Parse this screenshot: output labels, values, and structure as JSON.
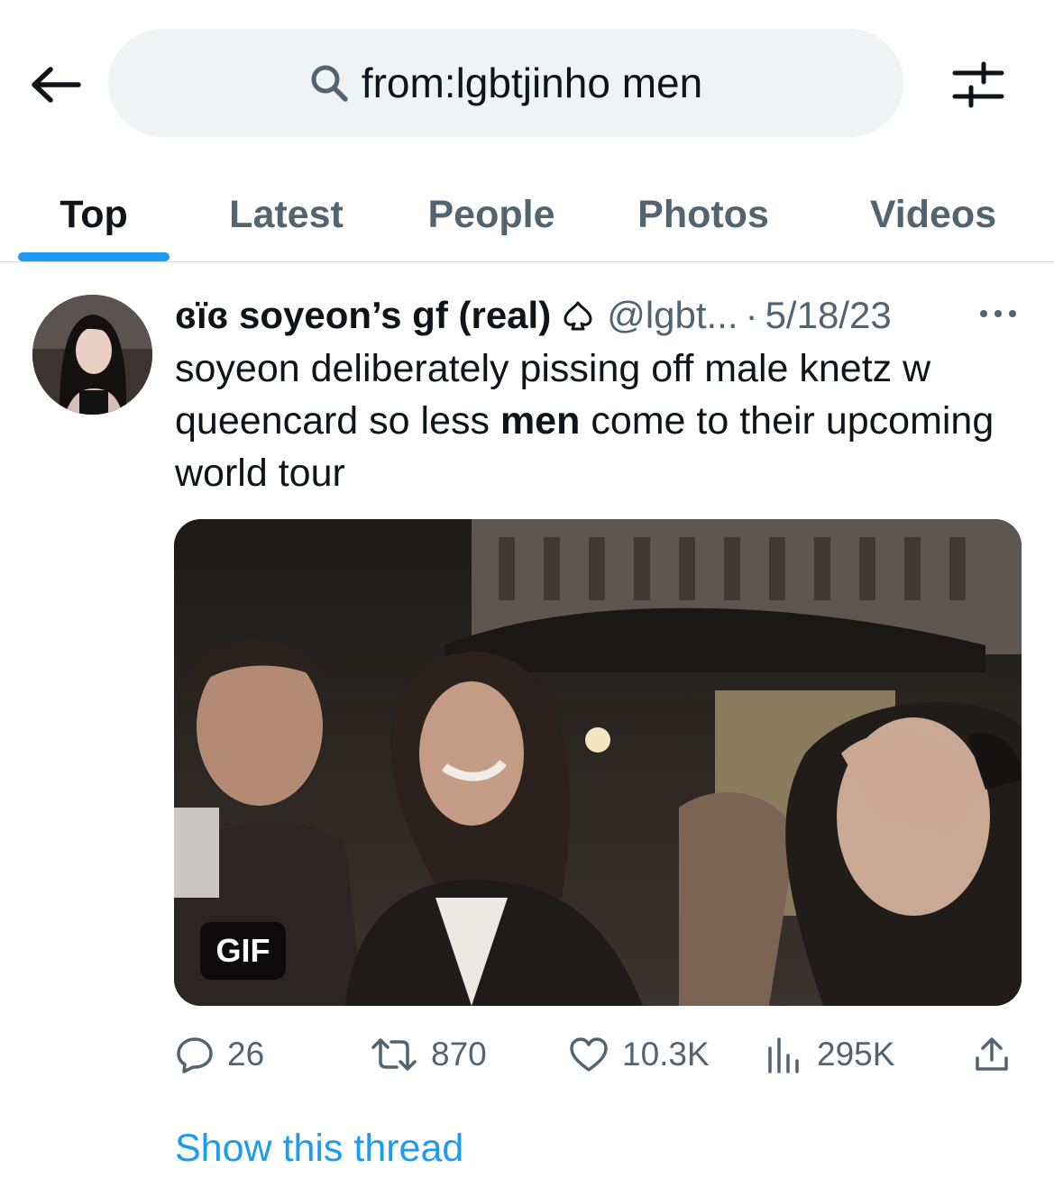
{
  "search": {
    "query": "from:lgbtjinho men",
    "icon": "search-icon"
  },
  "header": {
    "back_icon": "arrow-left-icon",
    "filter_icon": "sliders-icon"
  },
  "tabs": [
    {
      "label": "Top",
      "active": true
    },
    {
      "label": "Latest",
      "active": false
    },
    {
      "label": "People",
      "active": false
    },
    {
      "label": "Photos",
      "active": false
    },
    {
      "label": "Videos",
      "active": false
    }
  ],
  "tweet": {
    "display_name": "ɞïɞ soyeon’s gf (real)",
    "badge_icon": "spade-icon",
    "handle": "@lgbt...",
    "separator": "·",
    "date": "5/18/23",
    "more_icon": "more-horizontal-icon",
    "text_before": "soyeon deliberately pissing off male knetz w queencard so less ",
    "text_highlight": "men",
    "text_after": " come to their upcoming world tour",
    "media_badge": "GIF",
    "stats": {
      "replies": "26",
      "retweets": "870",
      "likes": "10.3K",
      "views": "295K"
    },
    "show_thread": "Show this thread"
  },
  "colors": {
    "accent": "#1d9bf0",
    "secondary_text": "#536471",
    "search_bg": "#eff3f4"
  }
}
